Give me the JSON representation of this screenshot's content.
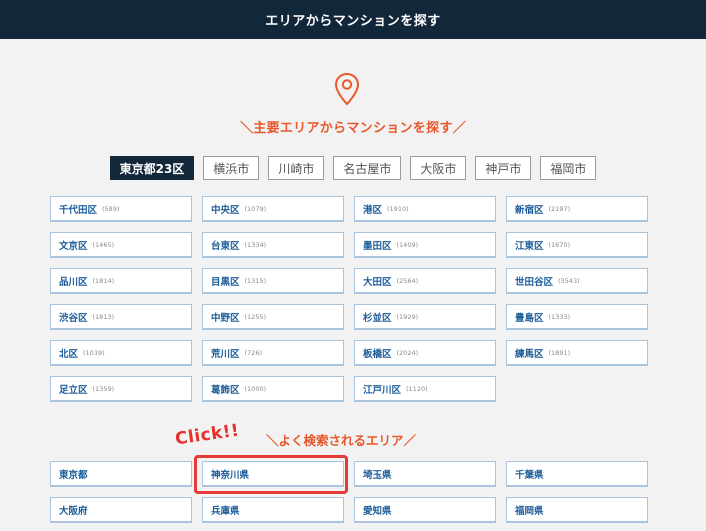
{
  "header": {
    "title": "エリアからマンションを探す"
  },
  "section_main": {
    "heading": "＼主要エリアからマンションを探す／"
  },
  "tabs": [
    {
      "label": "東京都23区",
      "active": true
    },
    {
      "label": "横浜市",
      "active": false
    },
    {
      "label": "川崎市",
      "active": false
    },
    {
      "label": "名古屋市",
      "active": false
    },
    {
      "label": "大阪市",
      "active": false
    },
    {
      "label": "神戸市",
      "active": false
    },
    {
      "label": "福岡市",
      "active": false
    }
  ],
  "wards": [
    {
      "name": "千代田区",
      "count": "(589)"
    },
    {
      "name": "中央区",
      "count": "(1079)"
    },
    {
      "name": "港区",
      "count": "(1910)"
    },
    {
      "name": "新宿区",
      "count": "(2197)"
    },
    {
      "name": "文京区",
      "count": "(1465)"
    },
    {
      "name": "台東区",
      "count": "(1334)"
    },
    {
      "name": "墨田区",
      "count": "(1409)"
    },
    {
      "name": "江東区",
      "count": "(1670)"
    },
    {
      "name": "品川区",
      "count": "(1814)"
    },
    {
      "name": "目黒区",
      "count": "(1315)"
    },
    {
      "name": "大田区",
      "count": "(2564)"
    },
    {
      "name": "世田谷区",
      "count": "(3543)"
    },
    {
      "name": "渋谷区",
      "count": "(1813)"
    },
    {
      "name": "中野区",
      "count": "(1255)"
    },
    {
      "name": "杉並区",
      "count": "(1929)"
    },
    {
      "name": "豊島区",
      "count": "(1333)"
    },
    {
      "name": "北区",
      "count": "(1039)"
    },
    {
      "name": "荒川区",
      "count": "(726)"
    },
    {
      "name": "板橋区",
      "count": "(2024)"
    },
    {
      "name": "練馬区",
      "count": "(1891)"
    },
    {
      "name": "足立区",
      "count": "(1359)"
    },
    {
      "name": "葛飾区",
      "count": "(1000)"
    },
    {
      "name": "江戸川区",
      "count": "(1120)"
    }
  ],
  "annotation": {
    "click_label": "Click!!"
  },
  "section_popular": {
    "heading": "＼よく検索されるエリア／"
  },
  "popular_areas": [
    "東京都",
    "神奈川県",
    "埼玉県",
    "千葉県",
    "大阪府",
    "兵庫県",
    "愛知県",
    "福岡県"
  ],
  "colors": {
    "header_bg": "#13273a",
    "accent": "#e8582a",
    "link": "#1c5c99",
    "highlight": "#e53a35"
  },
  "icons": {
    "location": "map-pin-icon"
  }
}
